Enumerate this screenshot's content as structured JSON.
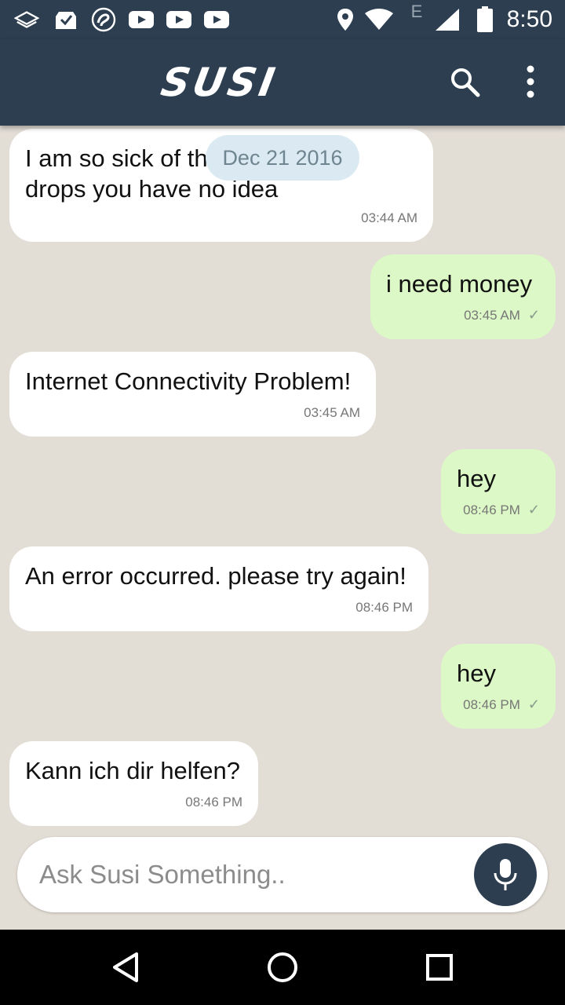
{
  "status_bar": {
    "time": "8:50",
    "network_label": "E",
    "icons": [
      "layers-icon",
      "inbox-check-icon",
      "swirl-icon",
      "youtube-icon",
      "youtube-icon",
      "youtube-icon",
      "location-icon",
      "wifi-icon",
      "signal-icon",
      "battery-icon"
    ]
  },
  "app_bar": {
    "title": "SUSI",
    "icons": [
      "search-icon",
      "more-vert-icon"
    ]
  },
  "chat": {
    "date_chip": "Dec 21 2016",
    "messages": [
      {
        "side": "in",
        "text": "I am so sick of this laugh\ndrops you have no idea",
        "time": "03:44 AM"
      },
      {
        "side": "out",
        "text": "i need money",
        "time": "03:45 AM"
      },
      {
        "side": "in",
        "text": "Internet Connectivity Problem!",
        "time": "03:45 AM"
      },
      {
        "side": "out",
        "text": "hey",
        "time": "08:46 PM"
      },
      {
        "side": "in",
        "text": "An error occurred. please try again!",
        "time": "08:46 PM"
      },
      {
        "side": "out",
        "text": "hey",
        "time": "08:46 PM"
      },
      {
        "side": "in",
        "text": "Kann ich dir helfen?",
        "time": "08:46 PM"
      }
    ],
    "tick_glyph": "✓"
  },
  "composer": {
    "placeholder": "Ask Susi Something..",
    "value": "",
    "mic_icon": "mic-icon"
  },
  "nav_bar": {
    "icons": [
      "back-triangle-icon",
      "home-circle-icon",
      "recents-square-icon"
    ]
  },
  "colors": {
    "primary": "#2c3e50",
    "background": "#e2ddd5",
    "incoming_bubble": "#ffffff",
    "outgoing_bubble": "#dcf8c6",
    "date_chip": "#dbeaf2"
  }
}
